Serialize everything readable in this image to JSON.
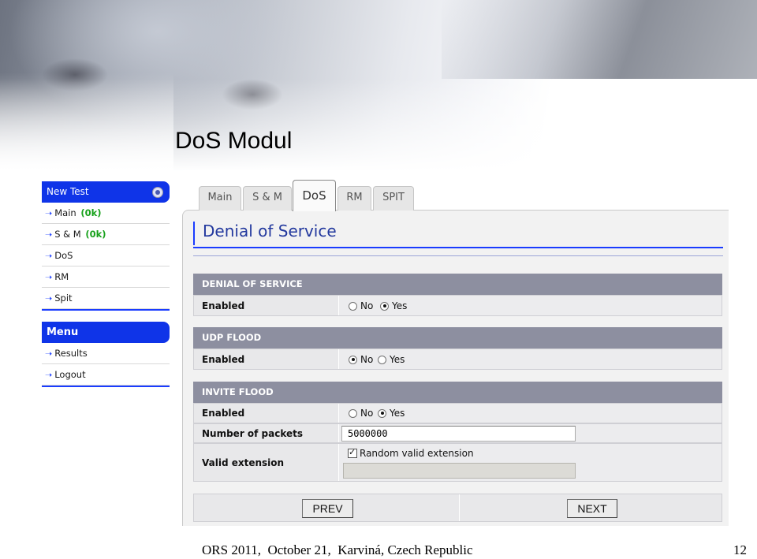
{
  "slide": {
    "title": "DoS Modul",
    "footer": "ORS 2011,  October 21,  Karviná, Czech Republic",
    "page_number": "12"
  },
  "sidebar": {
    "new_test": {
      "label": "New Test",
      "items": [
        {
          "label": "Main",
          "status": "(0k)"
        },
        {
          "label": "S & M",
          "status": "(0k)"
        },
        {
          "label": "DoS",
          "status": ""
        },
        {
          "label": "RM",
          "status": ""
        },
        {
          "label": "Spit",
          "status": ""
        }
      ]
    },
    "menu": {
      "label": "Menu",
      "items": [
        {
          "label": "Results"
        },
        {
          "label": "Logout"
        }
      ]
    }
  },
  "tabs": [
    {
      "label": "Main",
      "active": false
    },
    {
      "label": "S & M",
      "active": false
    },
    {
      "label": "DoS",
      "active": true
    },
    {
      "label": "RM",
      "active": false
    },
    {
      "label": "SPIT",
      "active": false
    }
  ],
  "page": {
    "title": "Denial of Service"
  },
  "sections": {
    "dos": {
      "header": "DENIAL OF SERVICE",
      "enabled_label": "Enabled",
      "no_label": "No",
      "yes_label": "Yes",
      "selected": "Yes"
    },
    "udp": {
      "header": "UDP FLOOD",
      "enabled_label": "Enabled",
      "no_label": "No",
      "yes_label": "Yes",
      "selected": "No"
    },
    "invite": {
      "header": "INVITE FLOOD",
      "enabled_label": "Enabled",
      "no_label": "No",
      "yes_label": "Yes",
      "selected": "Yes",
      "packets_label": "Number of packets",
      "packets_value": "5000000",
      "valid_ext_label": "Valid extension",
      "random_valid_label": "Random valid extension",
      "random_valid_checked": true,
      "extension_value": ""
    }
  },
  "buttons": {
    "prev": "PREV",
    "next": "NEXT"
  },
  "colors": {
    "accent": "#1a3cff",
    "section_header": "#8d8fa0",
    "ok_green": "#17a11b",
    "title_blue": "#23399e"
  },
  "icons": {
    "sidebar_arrow": "arrow-right-icon",
    "new_test_toggle": "collapse-circle-icon"
  }
}
